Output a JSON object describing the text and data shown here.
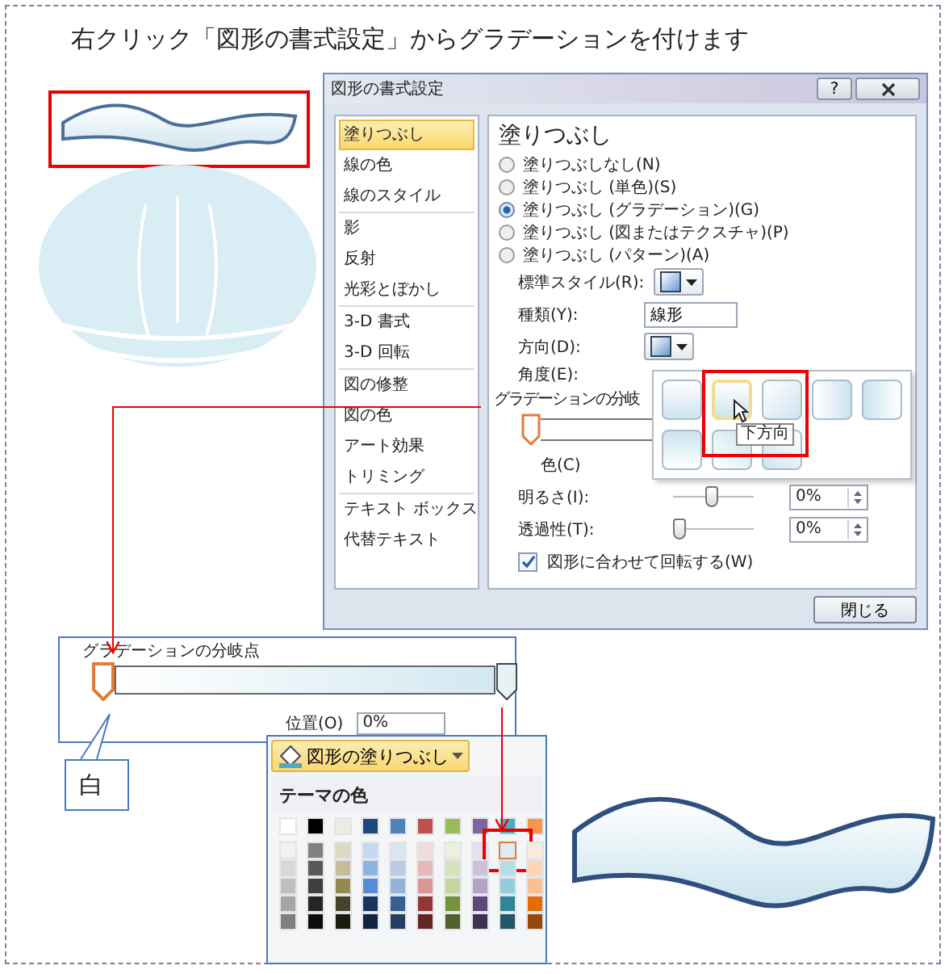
{
  "instruction": "右クリック「図形の書式設定」からグラデーションを付けます",
  "dialog": {
    "title": "図形の書式設定",
    "help": "?",
    "categories": [
      {
        "items": [
          {
            "label": "塗りつぶし",
            "selected": true
          },
          {
            "label": "線の色",
            "selected": false
          },
          {
            "label": "線のスタイル",
            "selected": false
          }
        ]
      },
      {
        "items": [
          {
            "label": "影",
            "selected": false
          },
          {
            "label": "反射",
            "selected": false
          },
          {
            "label": "光彩とぼかし",
            "selected": false
          }
        ]
      },
      {
        "items": [
          {
            "label": "3-D 書式",
            "selected": false
          },
          {
            "label": "3-D 回転",
            "selected": false
          }
        ]
      },
      {
        "items": [
          {
            "label": "図の修整",
            "selected": false
          },
          {
            "label": "図の色",
            "selected": false
          },
          {
            "label": "アート効果",
            "selected": false
          },
          {
            "label": "トリミング",
            "selected": false
          }
        ]
      },
      {
        "items": [
          {
            "label": "テキスト ボックス",
            "selected": false
          },
          {
            "label": "代替テキスト",
            "selected": false
          }
        ]
      }
    ],
    "heading": "塗りつぶし",
    "fill_options": [
      {
        "label": "塗りつぶしなし(N)",
        "selected": false
      },
      {
        "label": "塗りつぶし (単色)(S)",
        "selected": false
      },
      {
        "label": "塗りつぶし (グラデーション)(G)",
        "selected": true
      },
      {
        "label": "塗りつぶし (図またはテクスチャ)(P)",
        "selected": false
      },
      {
        "label": "塗りつぶし (パターン)(A)",
        "selected": false
      }
    ],
    "preset_label": "標準スタイル(R):",
    "type_label": "種類(Y):",
    "type_value": "線形",
    "direction_label": "方向(D):",
    "angle_label": "角度(E):",
    "stops_label": "グラデーションの分岐",
    "color_label": "色(C)",
    "brightness": {
      "label": "明るさ(I):",
      "level": 0.5,
      "value": "0%"
    },
    "transparency": {
      "label": "透過性(T):",
      "level": 0,
      "value": "0%"
    },
    "rotate": {
      "label": "図形に合わせて回転する(W)",
      "checked": true
    },
    "close": "閉じる",
    "direction_menu": {
      "tiles": [
        {
          "selected": false
        },
        {
          "selected": true
        },
        {
          "selected": false
        },
        {
          "selected": false
        },
        {
          "selected": false
        },
        {
          "selected": false
        },
        {
          "selected": false
        },
        {
          "selected": false
        }
      ],
      "tooltip": "下方向"
    }
  },
  "stops_zoom": {
    "label": "グラデーションの分岐点",
    "stops": [
      {
        "selected": true
      },
      {
        "selected": false
      }
    ],
    "position_label": "位置(O)",
    "position_value": "0%"
  },
  "callout": "白",
  "palette": {
    "button": "図形の塗りつぶし",
    "heading": "テーマの色",
    "rows": [
      [
        {
          "color": "#ffffff",
          "selected": false
        },
        {
          "color": "#000000",
          "selected": false
        },
        {
          "color": "#eeece1",
          "selected": false
        },
        {
          "color": "#1f497d",
          "selected": false
        },
        {
          "color": "#4f81bd",
          "selected": false
        },
        {
          "color": "#c0504d",
          "selected": false
        },
        {
          "color": "#9bbb59",
          "selected": false
        },
        {
          "color": "#8064a2",
          "selected": false
        },
        {
          "color": "#4bacc6",
          "selected": false
        },
        {
          "color": "#f79646",
          "selected": false
        }
      ],
      [
        {
          "color": "#f2f2f2",
          "selected": false
        },
        {
          "color": "#7f7f7f",
          "selected": false
        },
        {
          "color": "#ddd9c3",
          "selected": false
        },
        {
          "color": "#c6d9f0",
          "selected": false
        },
        {
          "color": "#dbe5f1",
          "selected": false
        },
        {
          "color": "#f2dcdb",
          "selected": false
        },
        {
          "color": "#ebf1dd",
          "selected": false
        },
        {
          "color": "#e5e0ec",
          "selected": false
        },
        {
          "color": "#dbeef3",
          "selected": true
        },
        {
          "color": "#fdeada",
          "selected": false
        }
      ],
      [
        {
          "color": "#d8d8d8",
          "selected": false
        },
        {
          "color": "#595959",
          "selected": false
        },
        {
          "color": "#c4bd97",
          "selected": false
        },
        {
          "color": "#8db3e2",
          "selected": false
        },
        {
          "color": "#b8cce4",
          "selected": false
        },
        {
          "color": "#e5b9b7",
          "selected": false
        },
        {
          "color": "#d7e3bc",
          "selected": false
        },
        {
          "color": "#ccc1d9",
          "selected": false
        },
        {
          "color": "#b7dde8",
          "selected": false
        },
        {
          "color": "#fbd5b5",
          "selected": false
        }
      ],
      [
        {
          "color": "#bfbfbf",
          "selected": false
        },
        {
          "color": "#3f3f3f",
          "selected": false
        },
        {
          "color": "#938953",
          "selected": false
        },
        {
          "color": "#548dd4",
          "selected": false
        },
        {
          "color": "#95b3d7",
          "selected": false
        },
        {
          "color": "#d99694",
          "selected": false
        },
        {
          "color": "#c3d69b",
          "selected": false
        },
        {
          "color": "#b2a2c7",
          "selected": false
        },
        {
          "color": "#92cddc",
          "selected": false
        },
        {
          "color": "#fac08f",
          "selected": false
        }
      ],
      [
        {
          "color": "#a5a5a5",
          "selected": false
        },
        {
          "color": "#262626",
          "selected": false
        },
        {
          "color": "#494429",
          "selected": false
        },
        {
          "color": "#17365d",
          "selected": false
        },
        {
          "color": "#366092",
          "selected": false
        },
        {
          "color": "#953734",
          "selected": false
        },
        {
          "color": "#76923c",
          "selected": false
        },
        {
          "color": "#5f497a",
          "selected": false
        },
        {
          "color": "#31859b",
          "selected": false
        },
        {
          "color": "#e36c09",
          "selected": false
        }
      ],
      [
        {
          "color": "#7f7f7f",
          "selected": false
        },
        {
          "color": "#0c0c0c",
          "selected": false
        },
        {
          "color": "#1d1b10",
          "selected": false
        },
        {
          "color": "#0f243e",
          "selected": false
        },
        {
          "color": "#244061",
          "selected": false
        },
        {
          "color": "#632423",
          "selected": false
        },
        {
          "color": "#4f6128",
          "selected": false
        },
        {
          "color": "#3f3151",
          "selected": false
        },
        {
          "color": "#205867",
          "selected": false
        },
        {
          "color": "#974806",
          "selected": false
        }
      ]
    ]
  }
}
